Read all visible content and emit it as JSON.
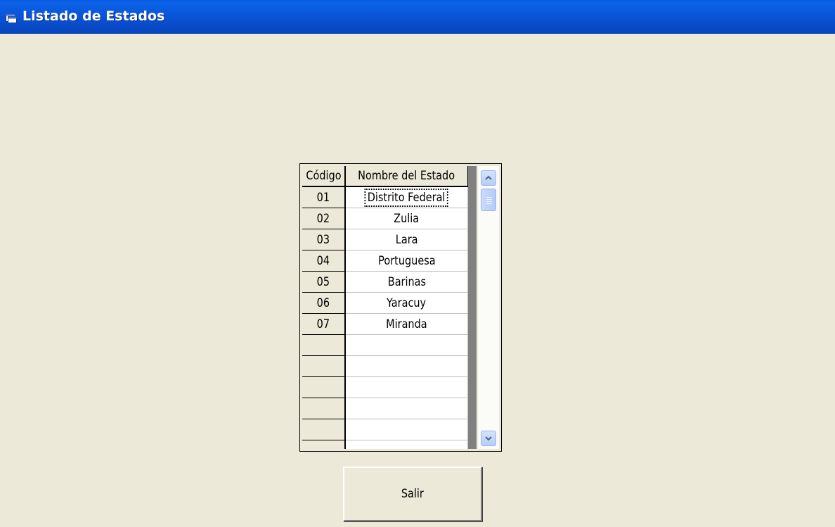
{
  "window": {
    "title": "Listado de Estados",
    "icon": "window-app-icon"
  },
  "grid": {
    "headers": {
      "code": "Código",
      "name": "Nombre del Estado"
    },
    "rows": [
      {
        "code": "01",
        "name": "Distrito Federal",
        "selected": true
      },
      {
        "code": "02",
        "name": "Zulia"
      },
      {
        "code": "03",
        "name": "Lara"
      },
      {
        "code": "04",
        "name": "Portuguesa"
      },
      {
        "code": "05",
        "name": "Barinas"
      },
      {
        "code": "06",
        "name": "Yaracuy"
      },
      {
        "code": "07",
        "name": "Miranda"
      },
      {
        "code": "",
        "name": ""
      },
      {
        "code": "",
        "name": ""
      },
      {
        "code": "",
        "name": ""
      },
      {
        "code": "",
        "name": ""
      },
      {
        "code": "",
        "name": ""
      },
      {
        "code": "",
        "name": ""
      }
    ],
    "scrollbar": {
      "up_icon": "chevron-up-icon",
      "down_icon": "chevron-down-icon"
    }
  },
  "buttons": {
    "exit_label": "Salir"
  },
  "colors": {
    "title_bar": "#0a55d8",
    "window_bg": "#ece9d8",
    "scroll_button": "#c3d6fb"
  }
}
